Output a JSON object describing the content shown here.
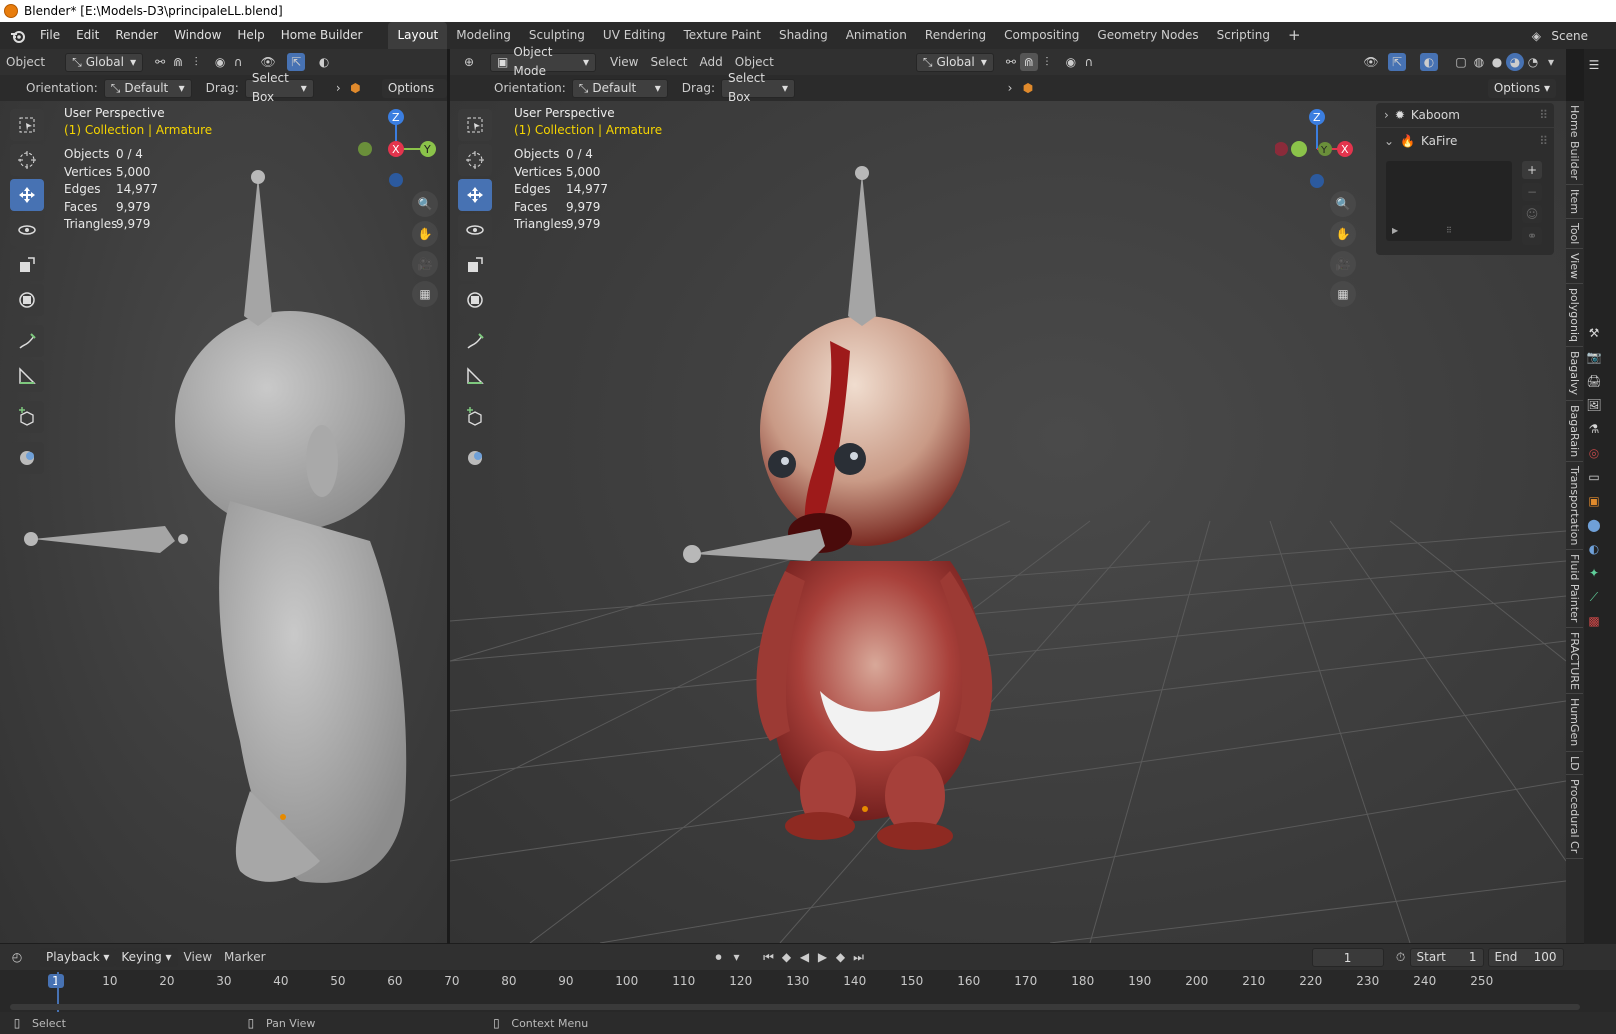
{
  "window": {
    "title": "Blender* [E:\\Models-D3\\principaleLL.blend]"
  },
  "menu": [
    "File",
    "Edit",
    "Render",
    "Window",
    "Help",
    "Home Builder"
  ],
  "workspaces": [
    "Layout",
    "Modeling",
    "Sculpting",
    "UV Editing",
    "Texture Paint",
    "Shading",
    "Animation",
    "Rendering",
    "Compositing",
    "Geometry Nodes",
    "Scripting"
  ],
  "active_workspace": "Layout",
  "scene_label": "Scene",
  "left_view": {
    "mode": "Object",
    "transform": "Global",
    "orientation_label": "Orientation:",
    "orientation_value": "Default",
    "drag_label": "Drag:",
    "drag_value": "Select Box",
    "options": "Options",
    "perspective": "User Perspective",
    "collection": "(1) Collection | Armature"
  },
  "right_view": {
    "mode": "Object Mode",
    "menus": [
      "View",
      "Select",
      "Add",
      "Object"
    ],
    "transform": "Global",
    "orientation_label": "Orientation:",
    "orientation_value": "Default",
    "drag_label": "Drag:",
    "drag_value": "Select Box",
    "options": "Options",
    "perspective": "User Perspective",
    "collection": "(1) Collection | Armature"
  },
  "stats": [
    {
      "key": "Objects",
      "value": "0 / 4"
    },
    {
      "key": "Vertices",
      "value": "5,000"
    },
    {
      "key": "Edges",
      "value": "14,977"
    },
    {
      "key": "Faces",
      "value": "9,979"
    },
    {
      "key": "Triangles",
      "value": "9,979"
    }
  ],
  "addon_panel": {
    "items": [
      {
        "label": "Kaboom",
        "expanded": false
      },
      {
        "label": "KaFire",
        "expanded": true
      }
    ]
  },
  "sidebar_tabs": [
    "Home Builder",
    "Item",
    "Tool",
    "View",
    "polygoniq",
    "Bagalvy",
    "BagaRain",
    "Transportation",
    "Fluid Painter",
    "FRACTURE",
    "HumGen",
    "LD",
    "Procedural Cr"
  ],
  "timeline": {
    "menus": [
      "Playback",
      "Keying",
      "View",
      "Marker"
    ],
    "current_frame": "1",
    "start_label": "Start",
    "start": "1",
    "end_label": "End",
    "end": "100",
    "ticks": [
      "1",
      "10",
      "20",
      "30",
      "40",
      "50",
      "60",
      "70",
      "80",
      "90",
      "100",
      "110",
      "120",
      "130",
      "140",
      "150",
      "160",
      "170",
      "180",
      "190",
      "200",
      "210",
      "220",
      "230",
      "240",
      "250"
    ]
  },
  "status_bar": [
    "Select",
    "Pan View",
    "Context Menu"
  ],
  "colors": {
    "accent": "#4772b3",
    "collection_text": "#f5d400",
    "axis_x": "#e3344d",
    "axis_y": "#8bc34a",
    "axis_z": "#3b7ee0"
  }
}
